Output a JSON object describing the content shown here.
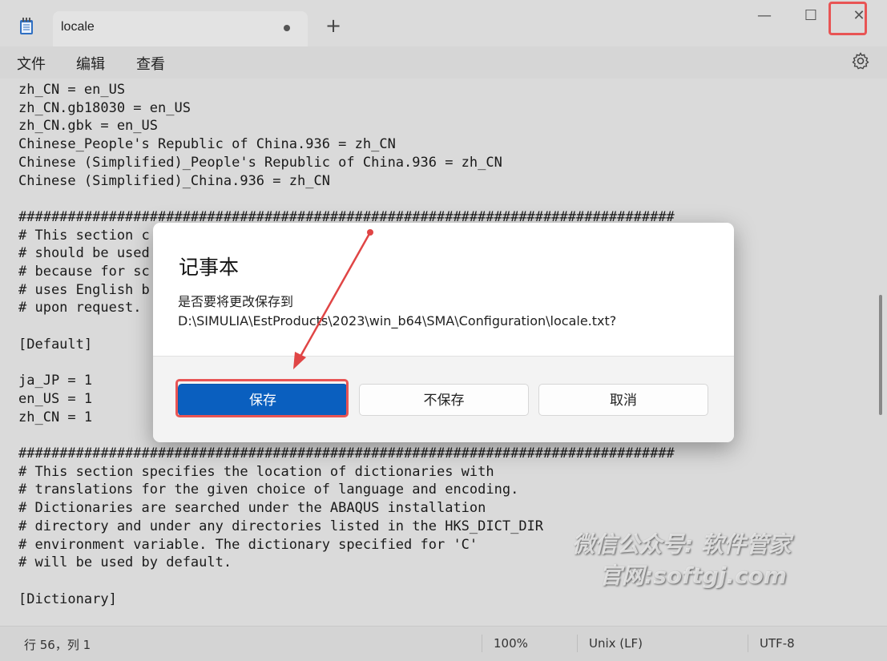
{
  "window": {
    "tab_title": "locale",
    "new_tab_symbol": "+",
    "minimize_symbol": "—",
    "maximize_symbol": "☐",
    "close_symbol": "✕",
    "app_icon": "notepad-icon",
    "accent_highlight": "#e85454"
  },
  "menu": {
    "file": "文件",
    "edit": "编辑",
    "view": "查看",
    "settings_icon": "gear-icon"
  },
  "editor": {
    "lines": [
      "zh_CN = en_US",
      "zh_CN.gb18030 = en_US",
      "zh_CN.gbk = en_US",
      "Chinese_People's Republic of China.936 = zh_CN",
      "Chinese (Simplified)_People's Republic of China.936 = zh_CN",
      "Chinese (Simplified)_China.936 = zh_CN",
      "",
      "################################################################################",
      "# This section c",
      "# should be used",
      "# because for sc",
      "# uses English b",
      "# upon request.",
      "",
      "[Default]",
      "",
      "ja_JP = 1",
      "en_US = 1",
      "zh_CN = 1",
      "",
      "################################################################################",
      "# This section specifies the location of dictionaries with",
      "# translations for the given choice of language and encoding.",
      "# Dictionaries are searched under the ABAQUS installation",
      "# directory and under any directories listed in the HKS_DICT_DIR",
      "# environment variable. The dictionary specified for 'C'",
      "# will be used by default.",
      "",
      "[Dictionary]"
    ]
  },
  "status": {
    "position": "行 56，列 1",
    "zoom": "100%",
    "line_ending": "Unix (LF)",
    "encoding": "UTF-8"
  },
  "dialog": {
    "title": "记事本",
    "message": "是否要将更改保存到 D:\\SIMULIA\\EstProducts\\2023\\win_b64\\SMA\\Configuration\\locale.txt?",
    "save": "保存",
    "dont_save": "不保存",
    "cancel": "取消",
    "primary_color": "#0a5fbf"
  },
  "watermark": {
    "line1": "微信公众号: 软件管家",
    "line2": "官网:softgj.com"
  }
}
